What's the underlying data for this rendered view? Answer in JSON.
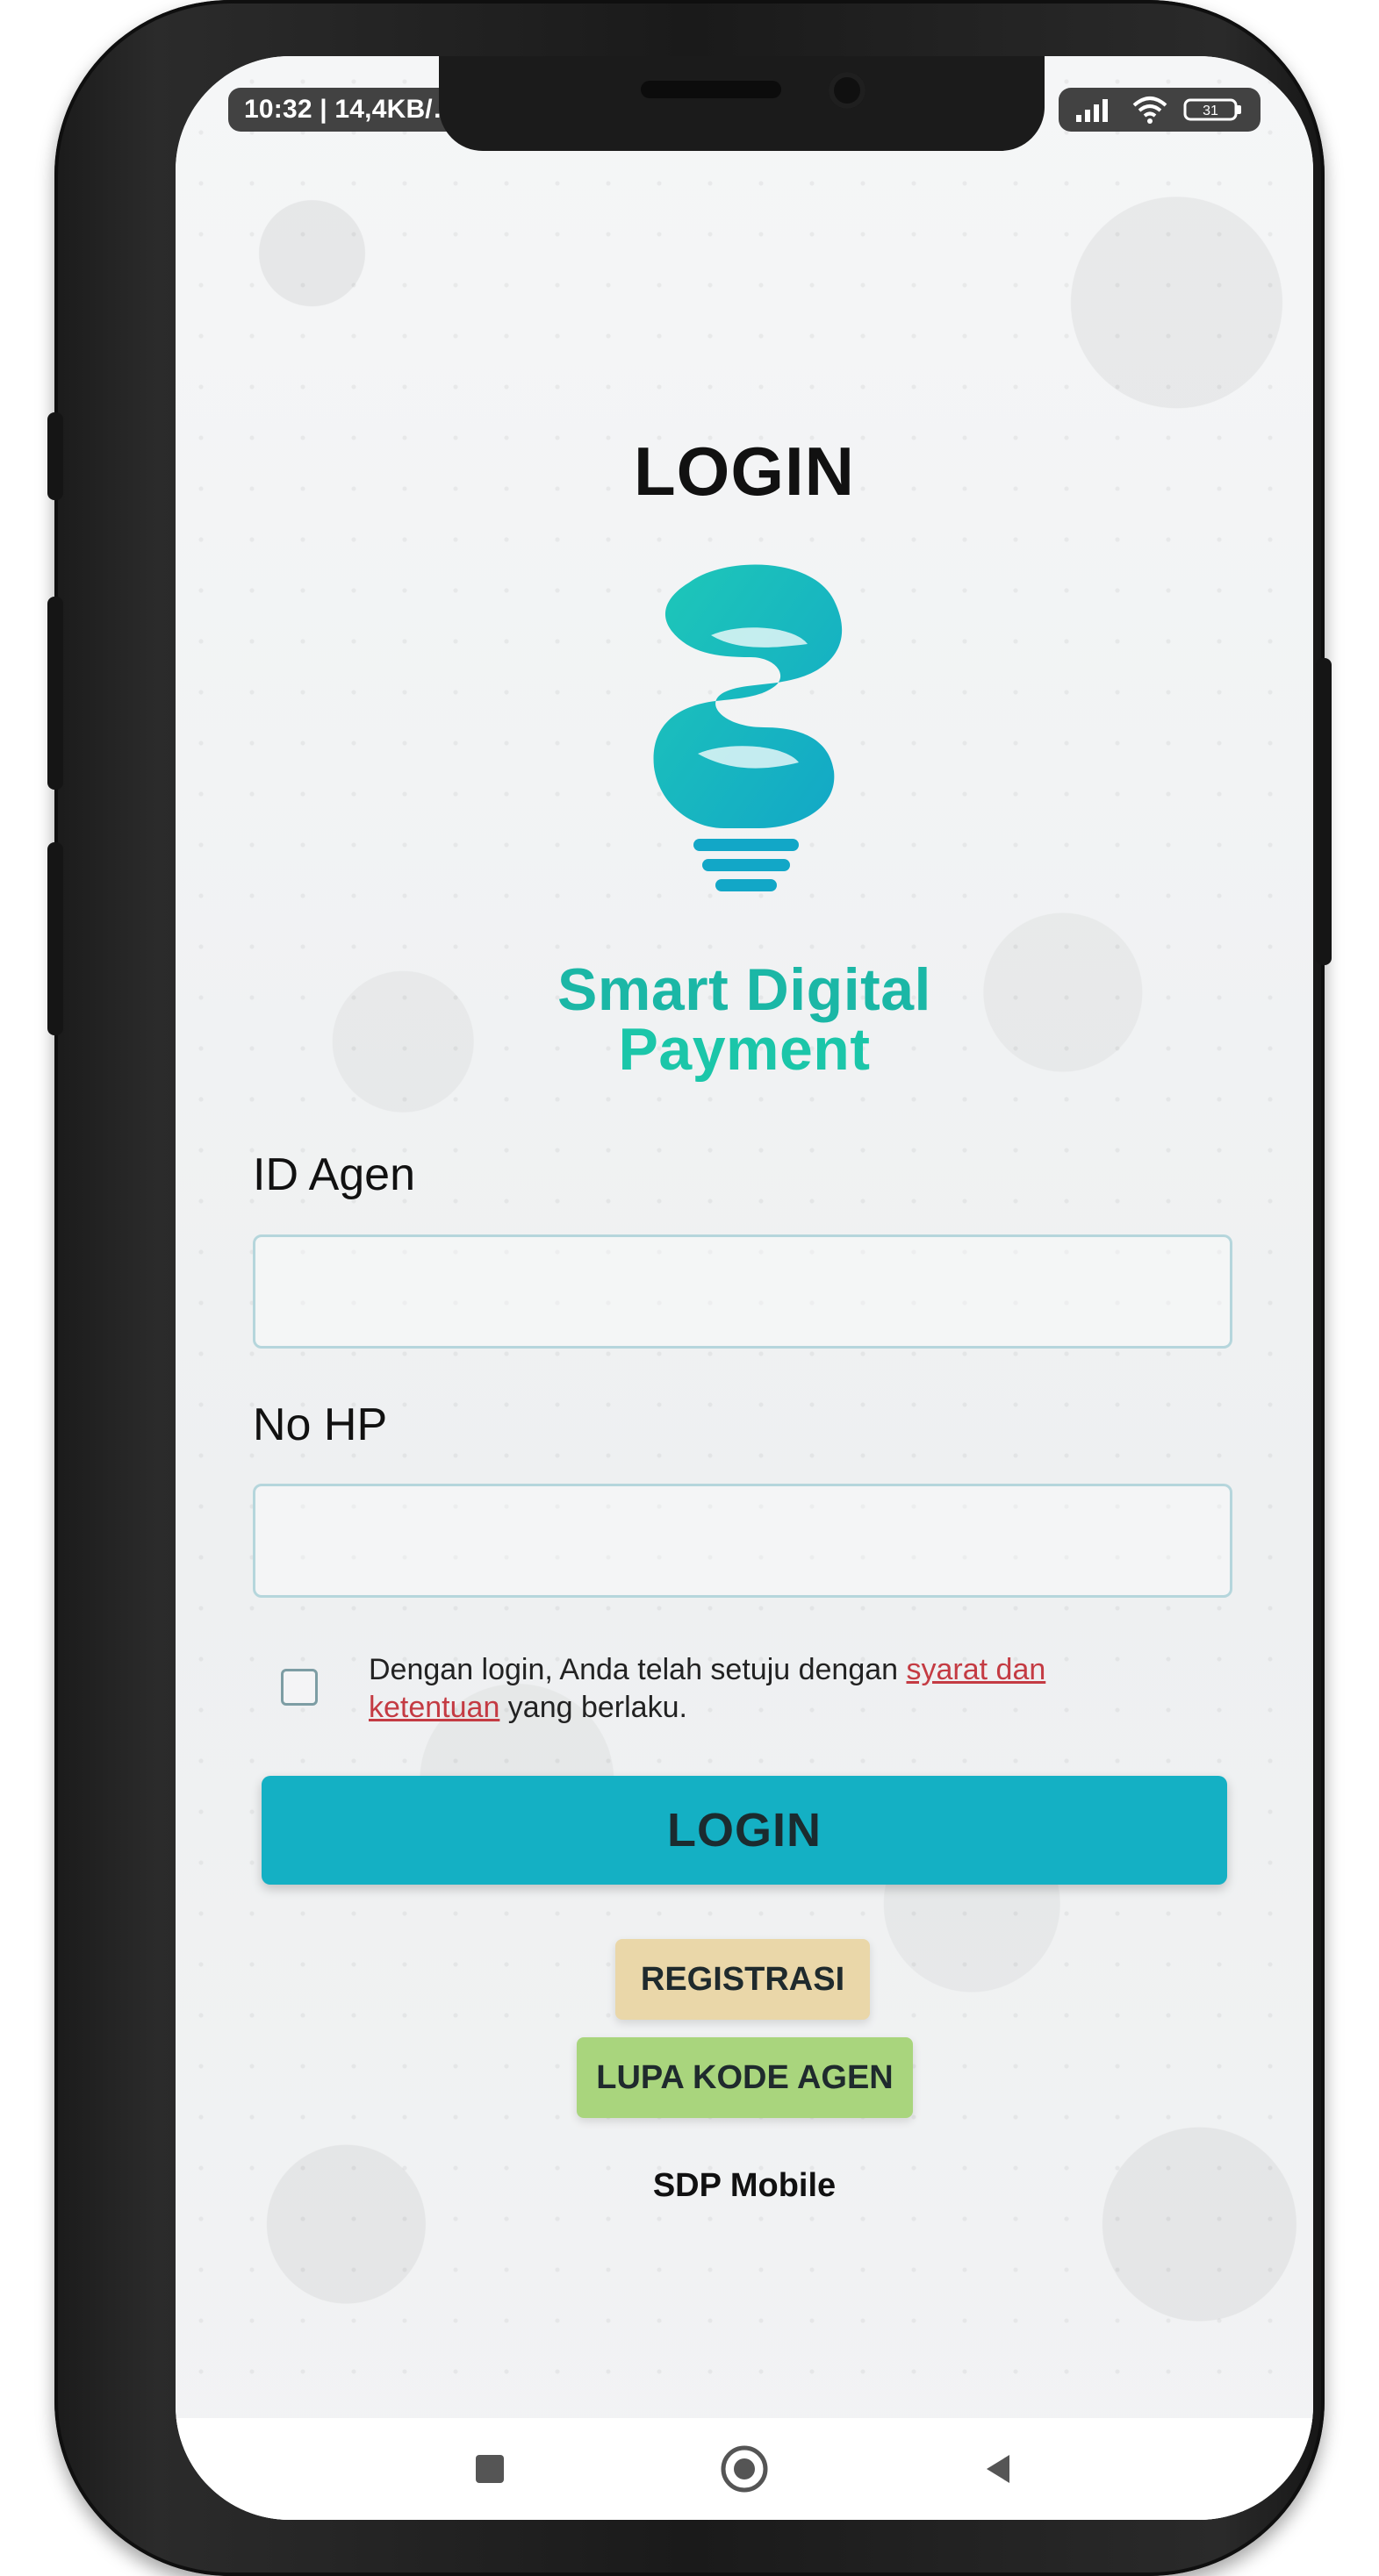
{
  "status_bar": {
    "left_text": "10:32 | 14,4KB/…",
    "signal_icon": "signal-icon",
    "wifi_icon": "wifi-icon",
    "battery_text": "31"
  },
  "page": {
    "title": "LOGIN",
    "brand_line1": "Smart Digital",
    "brand_line2": "Payment",
    "id_agen_label": "ID Agen",
    "id_agen_value": "",
    "no_hp_label": "No HP",
    "no_hp_value": "",
    "terms_prefix": "Dengan login, Anda telah setuju dengan ",
    "terms_link_1": "syarat dan",
    "terms_link_2": "ketentuan",
    "terms_suffix": " yang berlaku.",
    "login_button": "LOGIN",
    "register_button": "REGISTRASI",
    "forgot_button": "LUPA KODE AGEN",
    "footer": "SDP Mobile"
  },
  "colors": {
    "accent": "#14b0c4",
    "register": "#ead7a9",
    "forgot": "#a9d57d",
    "link": "#c43b43",
    "brand": "#1bb7a6"
  },
  "nav": {
    "recents_icon": "square-icon",
    "home_icon": "circle-icon",
    "back_icon": "triangle-left-icon"
  }
}
